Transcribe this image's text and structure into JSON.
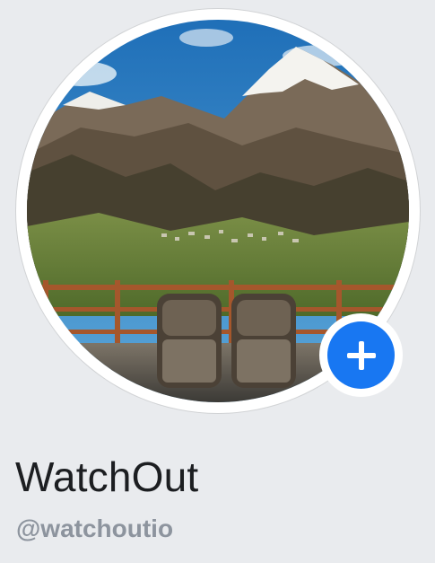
{
  "profile": {
    "name": "WatchOut",
    "handle": "@watchoutio"
  },
  "avatar": {
    "description_icon": "mountain-landscape-photo",
    "colors": {
      "sky": "#2e7fc4",
      "snow": "#f2f2f0",
      "mountain": "#6b5a45",
      "valley": "#6f8a3a",
      "fence": "#a5572c",
      "chair": "#4b4136"
    }
  },
  "add_button": {
    "icon": "plus-icon",
    "color": "#1877f2"
  },
  "colors": {
    "background": "#e9ebee",
    "name_text": "#1c1e21",
    "handle_text": "#8d949e"
  }
}
